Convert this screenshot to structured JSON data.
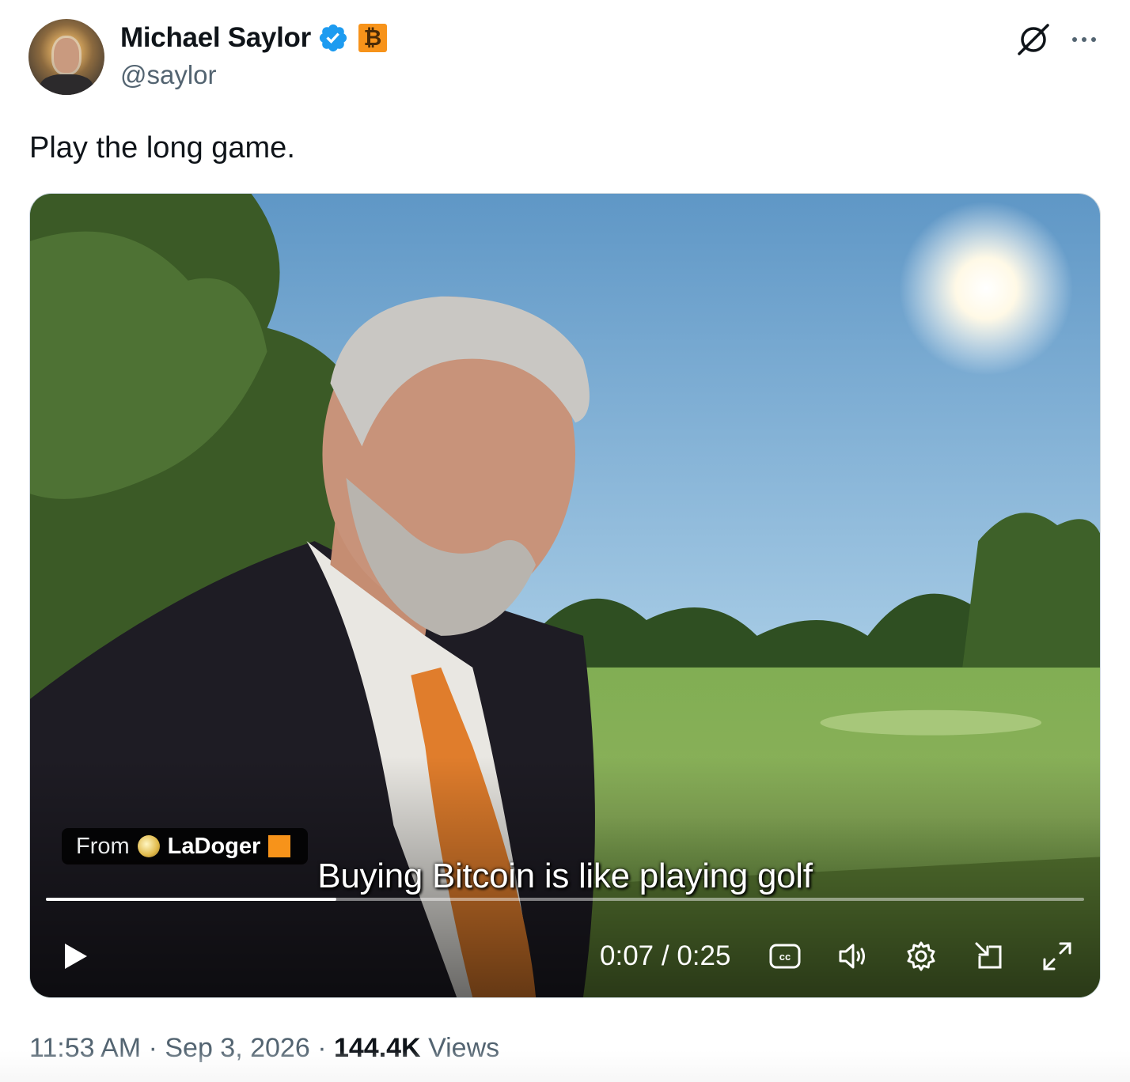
{
  "author": {
    "display_name": "Michael Saylor",
    "handle": "@saylor",
    "badge_symbol": "₿",
    "verified_color": "#1d9bf0",
    "badge_color": "#f7931a"
  },
  "tweet": {
    "text": "Play the long game."
  },
  "video": {
    "from_label": "From",
    "source_name": "LaDoger",
    "subtitle": "Buying Bitcoin is like playing golf",
    "current_time": "0:07",
    "duration": "0:25",
    "time_separator": " / ",
    "progress_fraction": 0.28,
    "controls": [
      "play-icon",
      "closed-captions-icon",
      "volume-icon",
      "settings-gear-icon",
      "picture-in-picture-icon",
      "fullscreen-icon"
    ]
  },
  "meta": {
    "time": "11:53 AM",
    "date": "Sep 3, 2026",
    "separator": " · ",
    "views_count": "144.4K",
    "views_label": "Views"
  }
}
